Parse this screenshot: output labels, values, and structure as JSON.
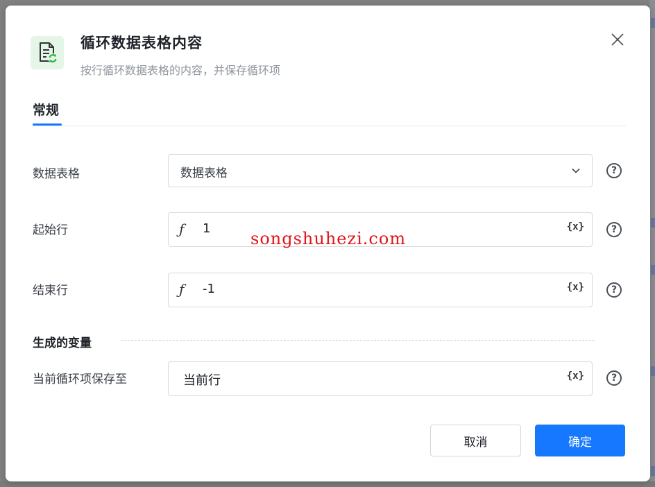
{
  "dialog": {
    "title": "循环数据表格内容",
    "subtitle": "按行循环数据表格的内容，并保存循环项",
    "close_icon": "close-icon",
    "app_icon": "table-loop-icon"
  },
  "tabs": [
    {
      "label": "常规",
      "active": true
    }
  ],
  "fields": {
    "table": {
      "label": "数据表格",
      "value": "数据表格",
      "icon": "chevron-down-icon"
    },
    "start_row": {
      "label": "起始行",
      "value": "1",
      "prefix": "ƒ",
      "var_button": "{x}"
    },
    "end_row": {
      "label": "结束行",
      "value": "-1",
      "prefix": "ƒ",
      "var_button": "{x}"
    }
  },
  "output": {
    "section_title": "生成的变量",
    "save_to": {
      "label": "当前循环项保存至",
      "value": "当前行",
      "var_button": "{x}"
    }
  },
  "help_icon_text": "?",
  "buttons": {
    "cancel": "取消",
    "ok": "确定"
  },
  "watermark": "songshuhezi.com",
  "colors": {
    "primary": "#1677ff",
    "app_icon_bg": "#e5f5e7",
    "app_icon_accent": "#2fb344",
    "watermark": "#e2141a"
  }
}
